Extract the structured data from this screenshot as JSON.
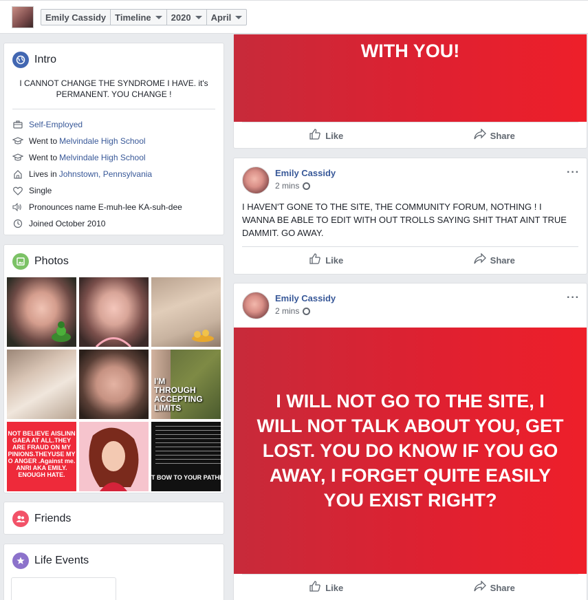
{
  "topbar": {
    "profile_name": "Emily Cassidy",
    "crumbs": [
      "Timeline",
      "2020",
      "April"
    ]
  },
  "intro": {
    "title": "Intro",
    "bio": "I CANNOT CHANGE THE SYNDROME I HAVE. it's PERMANENT. YOU CHANGE !",
    "rows": {
      "work": "Self-Employed",
      "edu1_prefix": "Went to ",
      "edu1_link": "Melvindale High School",
      "edu2_prefix": "Went to ",
      "edu2_link": "Melvindale High School",
      "lives_prefix": "Lives in ",
      "lives_link": "Johnstown, Pennsylvania",
      "relationship": "Single",
      "pronounce": "Pronounces name E-muh-lee KA-suh-dee",
      "joined": "Joined October 2010"
    },
    "icons": [
      "briefcase-icon",
      "graduation-cap-icon",
      "graduation-cap-icon",
      "home-icon",
      "heart-icon",
      "speaker-icon",
      "clock-icon"
    ]
  },
  "photos": {
    "title": "Photos",
    "tile6_text": "I'M THROUGH ACCEPTING LIMITS",
    "tile7_text": "NOT BELIEVE AISLINN GAEA AT ALL.THEY ARE FRAUD ON MY PINIONS.THEYUSE MY O ANGER .Against me. ANRI AKA EMILY. ENOUGH HATE.",
    "tile9_text": "T BOW TO YOUR PATHET"
  },
  "friends": {
    "title": "Friends"
  },
  "life_events": {
    "title": "Life Events"
  },
  "posts": [
    {
      "banner_text": "WITH YOU!",
      "like": "Like",
      "share": "Share"
    },
    {
      "author": "Emily Cassidy",
      "time": "2 mins",
      "more": "···",
      "body": "I HAVEN'T GONE TO THE SITE, THE COMMUNITY FORUM, NOTHING ! I WANNA BE ABLE TO EDIT WITH OUT TROLLS SAYING SHIT THAT AINT TRUE DAMMIT. GO AWAY.",
      "like": "Like",
      "share": "Share"
    },
    {
      "author": "Emily Cassidy",
      "time": "2 mins",
      "more": "···",
      "banner_text": "I WILL NOT GO TO THE SITE, I WILL NOT TALK ABOUT YOU, GET LOST. YOU DO KNOW IF YOU GO AWAY, I FORGET QUITE EASILY YOU EXIST RIGHT?",
      "like": "Like",
      "share": "Share"
    }
  ],
  "colors": {
    "link": "#385898",
    "banner_red": "#e02030",
    "intro_icon": "#4267b2",
    "photos_icon": "#7cc266",
    "friends_icon": "#f25268",
    "events_icon": "#8c72cb"
  }
}
